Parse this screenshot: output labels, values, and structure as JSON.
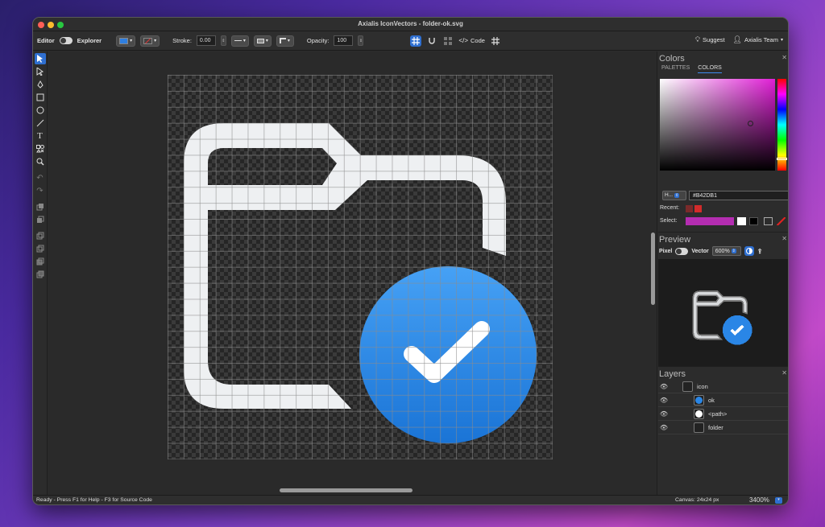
{
  "window": {
    "title": "Axialis IconVectors - folder-ok.svg"
  },
  "toolbar": {
    "editor_label": "Editor",
    "explorer_label": "Explorer",
    "fill_color": "#2f7fe0",
    "stroke_color": "#d13a3a",
    "stroke_label": "Stroke:",
    "stroke_value": "0.00",
    "opacity_label": "Opacity:",
    "opacity_value": "100",
    "code_label": "Code",
    "suggest_label": "Suggest",
    "account_label": "Axialis Team"
  },
  "canvas": {
    "folder_color": "#eef0f2",
    "badge_color_top": "#46a1f5",
    "badge_color_bottom": "#1a74d6"
  },
  "colors_panel": {
    "title": "Colors",
    "tabs": [
      "PALETTES",
      "COLORS"
    ],
    "active_tab": "COLORS",
    "mode": "H...",
    "hex_value": "#B42DB1",
    "recent_label": "Recent:",
    "recent_colors": [
      "#7a2a2a",
      "#d32b2b"
    ],
    "select_label": "Select:",
    "select_color": "#b42db1"
  },
  "preview_panel": {
    "title": "Preview",
    "pixel_label": "Pixel",
    "vector_label": "Vector",
    "zoom": "600%"
  },
  "layers_panel": {
    "title": "Layers",
    "items": [
      {
        "name": "icon"
      },
      {
        "name": "ok"
      },
      {
        "name": "<path>"
      },
      {
        "name": "folder"
      }
    ]
  },
  "status": {
    "left": "Ready - Press F1 for Help - F3 for Source Code",
    "canvas": "Canvas: 24x24 px",
    "zoom": "3400%"
  }
}
